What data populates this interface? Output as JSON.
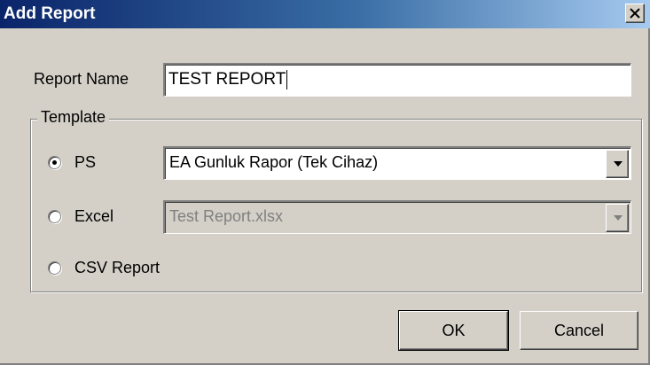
{
  "dialog": {
    "title": "Add Report",
    "close_icon": "close-x-icon"
  },
  "report_name": {
    "label": "Report Name",
    "value": "TEST REPORT"
  },
  "template": {
    "legend": "Template",
    "options": [
      {
        "label": "PS",
        "selected": true,
        "combo_value": "EA Gunluk Rapor (Tek Cihaz)",
        "combo_enabled": true
      },
      {
        "label": "Excel",
        "selected": false,
        "combo_value": "Test Report.xlsx",
        "combo_enabled": false
      },
      {
        "label": "CSV Report",
        "selected": false
      }
    ]
  },
  "buttons": {
    "ok_label": "OK",
    "cancel_label": "Cancel"
  },
  "colors": {
    "title_gradient_start": "#0a246a",
    "title_gradient_end": "#a6caf0",
    "face": "#d4d0c8"
  }
}
